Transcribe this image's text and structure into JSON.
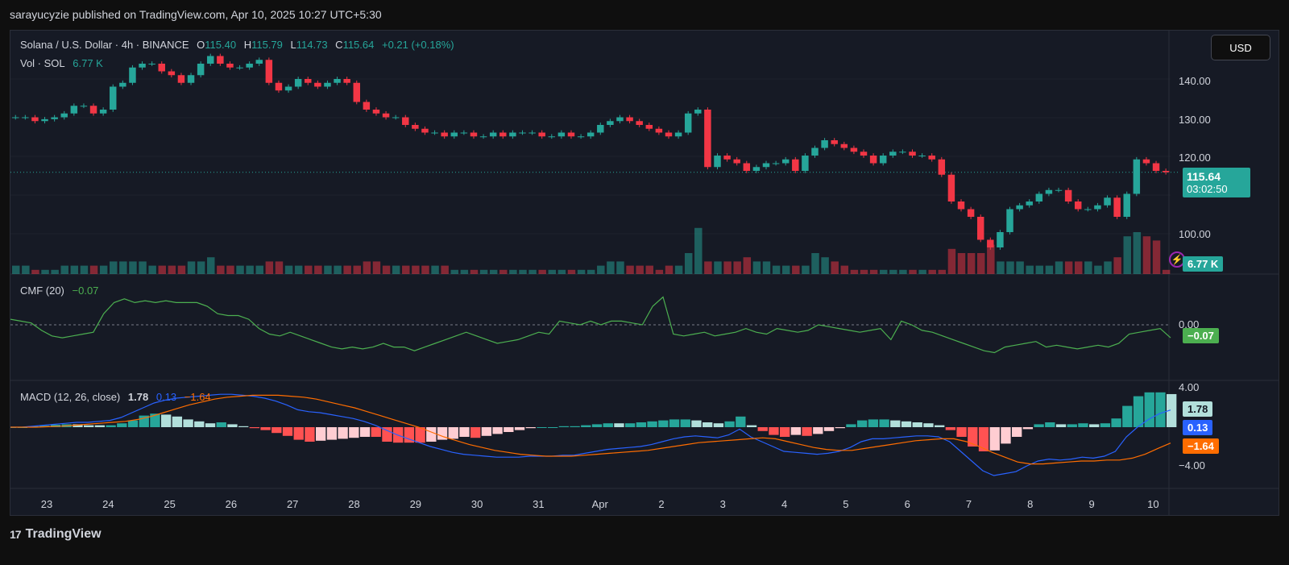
{
  "header": {
    "published": "sarayucyzie published on TradingView.com, Apr 10, 2025 10:27 UTC+5:30"
  },
  "legend": {
    "symbol": "Solana / U.S. Dollar · 4h · BINANCE",
    "o_label": "O",
    "o": "115.40",
    "h_label": "H",
    "h": "115.79",
    "l_label": "L",
    "l": "114.73",
    "c_label": "C",
    "c": "115.64",
    "change": "+0.21 (+0.18%)",
    "vol_label": "Vol · SOL",
    "vol": "6.77 K"
  },
  "currency": "USD",
  "price_axis": [
    "140.00",
    "130.00",
    "120.00",
    "100.00"
  ],
  "last_price": {
    "value": "115.64",
    "countdown": "03:02:50"
  },
  "vol_tag": "6.77 K",
  "cmf": {
    "label": "CMF (20)",
    "value": "−0.07",
    "axis": "0.00",
    "tag": "−0.07"
  },
  "macd": {
    "label": "MACD (12, 26, close)",
    "macd": "1.78",
    "signal": "0.13",
    "hist": "−1.64",
    "axis": [
      "4.00",
      "−4.00"
    ],
    "tags": [
      "1.78",
      "0.13",
      "−1.64"
    ]
  },
  "time_axis": [
    "23",
    "24",
    "25",
    "26",
    "27",
    "28",
    "29",
    "30",
    "31",
    "Apr",
    "2",
    "3",
    "4",
    "5",
    "6",
    "7",
    "8",
    "9",
    "10"
  ],
  "footer": {
    "brand": "TradingView",
    "logo": "17"
  },
  "colors": {
    "up": "#26a69a",
    "down": "#f23645",
    "cmf": "#4caf50",
    "macd": "#2962ff",
    "signal": "#ff6d00"
  },
  "chart_data": {
    "type": "candlestick",
    "price_closes": [
      130,
      130,
      129,
      129.5,
      130,
      131,
      133,
      133,
      131,
      132,
      138,
      139,
      143,
      144,
      144,
      142,
      141,
      139,
      141,
      144,
      146,
      144,
      143,
      143,
      144,
      145,
      139,
      137,
      138,
      140,
      139,
      138,
      139,
      140,
      139,
      134,
      132,
      131,
      130,
      130,
      128,
      127,
      126,
      126,
      125,
      126,
      126,
      125,
      125,
      126,
      125,
      126,
      126,
      126,
      125,
      125,
      126,
      125,
      125,
      126,
      128,
      129,
      130,
      129,
      128,
      127,
      126,
      125,
      126,
      131,
      132,
      117,
      120,
      119,
      118,
      116,
      117,
      118,
      118,
      119,
      116,
      120,
      122,
      124,
      123,
      122,
      121,
      120,
      118,
      120,
      121,
      121,
      120,
      120,
      119,
      115,
      108,
      106,
      104,
      98,
      96,
      100,
      106,
      107,
      108,
      110,
      111,
      111,
      108,
      106,
      106,
      107,
      109,
      104,
      110,
      119,
      118,
      116,
      115.64
    ],
    "volume": [
      2,
      2,
      1,
      1,
      1,
      2,
      2,
      2,
      2,
      2,
      3,
      3,
      3,
      3,
      2,
      2,
      2,
      2,
      3,
      3,
      4,
      2,
      2,
      2,
      2,
      2,
      3,
      3,
      2,
      2,
      2,
      2,
      2,
      2,
      2,
      2,
      3,
      3,
      2,
      2,
      2,
      2,
      2,
      2,
      2,
      1,
      1,
      1,
      1,
      1,
      1,
      1,
      1,
      1,
      1,
      1,
      1,
      1,
      1,
      1,
      2,
      3,
      3,
      2,
      2,
      2,
      1,
      2,
      2,
      5,
      11,
      3,
      3,
      3,
      3,
      4,
      3,
      3,
      2,
      2,
      2,
      2,
      5,
      4,
      3,
      2,
      1,
      1,
      1,
      1,
      1,
      1,
      1,
      1,
      1,
      1,
      6,
      5,
      5,
      5,
      7,
      3,
      3,
      3,
      2,
      2,
      2,
      3,
      3,
      3,
      3,
      2,
      3,
      4,
      9,
      10,
      9,
      8,
      1
    ],
    "cmf": [
      0.03,
      0.02,
      0.01,
      -0.03,
      -0.06,
      -0.07,
      -0.06,
      -0.05,
      -0.04,
      0.06,
      0.12,
      0.14,
      0.12,
      0.13,
      0.12,
      0.13,
      0.12,
      0.12,
      0.12,
      0.1,
      0.06,
      0.05,
      0.05,
      0.03,
      -0.02,
      -0.05,
      -0.06,
      -0.04,
      -0.06,
      -0.08,
      -0.1,
      -0.12,
      -0.13,
      -0.12,
      -0.13,
      -0.12,
      -0.1,
      -0.12,
      -0.12,
      -0.14,
      -0.12,
      -0.1,
      -0.08,
      -0.06,
      -0.04,
      -0.06,
      -0.08,
      -0.1,
      -0.09,
      -0.08,
      -0.06,
      -0.04,
      -0.05,
      0.02,
      0.01,
      0.0,
      0.02,
      0.0,
      0.02,
      0.02,
      0.01,
      0.0,
      0.1,
      0.15,
      -0.05,
      -0.06,
      -0.05,
      -0.04,
      -0.06,
      -0.05,
      -0.04,
      -0.02,
      -0.04,
      -0.05,
      -0.02,
      -0.03,
      -0.04,
      -0.03,
      0.0,
      -0.01,
      -0.02,
      -0.03,
      -0.04,
      -0.03,
      -0.02,
      -0.08,
      0.02,
      0.0,
      -0.03,
      -0.04,
      -0.06,
      -0.08,
      -0.1,
      -0.12,
      -0.14,
      -0.15,
      -0.12,
      -0.11,
      -0.1,
      -0.09,
      -0.12,
      -0.11,
      -0.12,
      -0.13,
      -0.12,
      -0.11,
      -0.12,
      -0.1,
      -0.05,
      -0.04,
      -0.03,
      -0.02,
      -0.07
    ],
    "macd": [
      0,
      0,
      0.1,
      0.2,
      0.3,
      0.4,
      0.5,
      0.5,
      0.6,
      0.7,
      1.0,
      1.5,
      2.0,
      2.5,
      2.8,
      3.0,
      3.1,
      3.2,
      3.3,
      3.4,
      3.4,
      3.3,
      3.2,
      3.0,
      2.7,
      2.3,
      1.8,
      1.6,
      1.5,
      1.3,
      1.1,
      0.9,
      0.6,
      0.2,
      -0.3,
      -0.8,
      -1.2,
      -1.6,
      -2.0,
      -2.3,
      -2.6,
      -2.8,
      -2.9,
      -3.0,
      -3.1,
      -3.1,
      -3.1,
      -3.0,
      -3.0,
      -3.0,
      -2.9,
      -2.9,
      -2.7,
      -2.5,
      -2.3,
      -2.2,
      -2.1,
      -2.0,
      -1.8,
      -1.5,
      -1.2,
      -1.0,
      -0.9,
      -1.0,
      -1.1,
      -0.8,
      -0.2,
      -1.0,
      -1.5,
      -2.0,
      -2.5,
      -2.6,
      -2.7,
      -2.8,
      -2.7,
      -2.5,
      -2.1,
      -1.5,
      -1.2,
      -1.2,
      -1.1,
      -1.0,
      -0.9,
      -0.9,
      -1.0,
      -1.5,
      -2.5,
      -3.5,
      -4.5,
      -5.0,
      -4.8,
      -4.6,
      -4.0,
      -3.5,
      -3.3,
      -3.4,
      -3.3,
      -3.1,
      -3.2,
      -3.0,
      -2.5,
      -1.0,
      0.0,
      0.8,
      1.4,
      1.78
    ],
    "signal": [
      0,
      0,
      0,
      0.05,
      0.1,
      0.2,
      0.3,
      0.4,
      0.5,
      0.6,
      0.8,
      1.1,
      1.5,
      1.9,
      2.3,
      2.6,
      2.9,
      3.1,
      3.2,
      3.3,
      3.3,
      3.3,
      3.2,
      3.1,
      2.9,
      2.6,
      2.3,
      2.0,
      1.6,
      1.2,
      0.8,
      0.4,
      0.0,
      -0.5,
      -1.0,
      -1.4,
      -1.8,
      -2.1,
      -2.4,
      -2.6,
      -2.8,
      -2.9,
      -3.0,
      -3.0,
      -3.0,
      -2.9,
      -2.8,
      -2.7,
      -2.6,
      -2.5,
      -2.4,
      -2.2,
      -2.0,
      -1.8,
      -1.6,
      -1.5,
      -1.4,
      -1.3,
      -1.2,
      -1.1,
      -1.2,
      -1.5,
      -1.8,
      -2.1,
      -2.3,
      -2.4,
      -2.4,
      -2.2,
      -2.0,
      -1.8,
      -1.6,
      -1.4,
      -1.3,
      -1.2,
      -1.2,
      -1.5,
      -2.0,
      -2.6,
      -3.1,
      -3.6,
      -3.8,
      -3.8,
      -3.7,
      -3.6,
      -3.5,
      -3.5,
      -3.4,
      -3.4,
      -3.2,
      -2.8,
      -2.2,
      -1.64
    ]
  }
}
